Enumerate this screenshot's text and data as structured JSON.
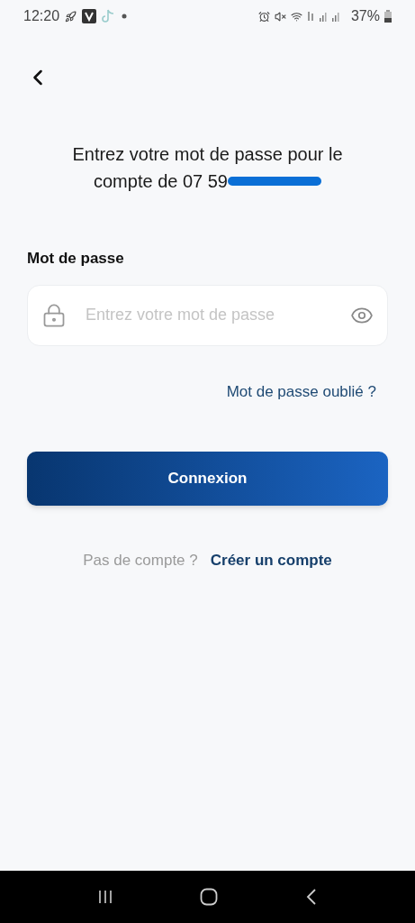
{
  "status_bar": {
    "time": "12:20",
    "battery": "37%"
  },
  "heading": {
    "line_1": "Entrez votre mot de passe pour le",
    "line_2": "compte de 07 59"
  },
  "password": {
    "label": "Mot de passe",
    "placeholder": "Entrez votre mot de passe"
  },
  "forgot_link": "Mot de passe oublié ?",
  "login_button": "Connexion",
  "signup": {
    "prompt": "Pas de compte ?",
    "link": "Créer un compte"
  }
}
